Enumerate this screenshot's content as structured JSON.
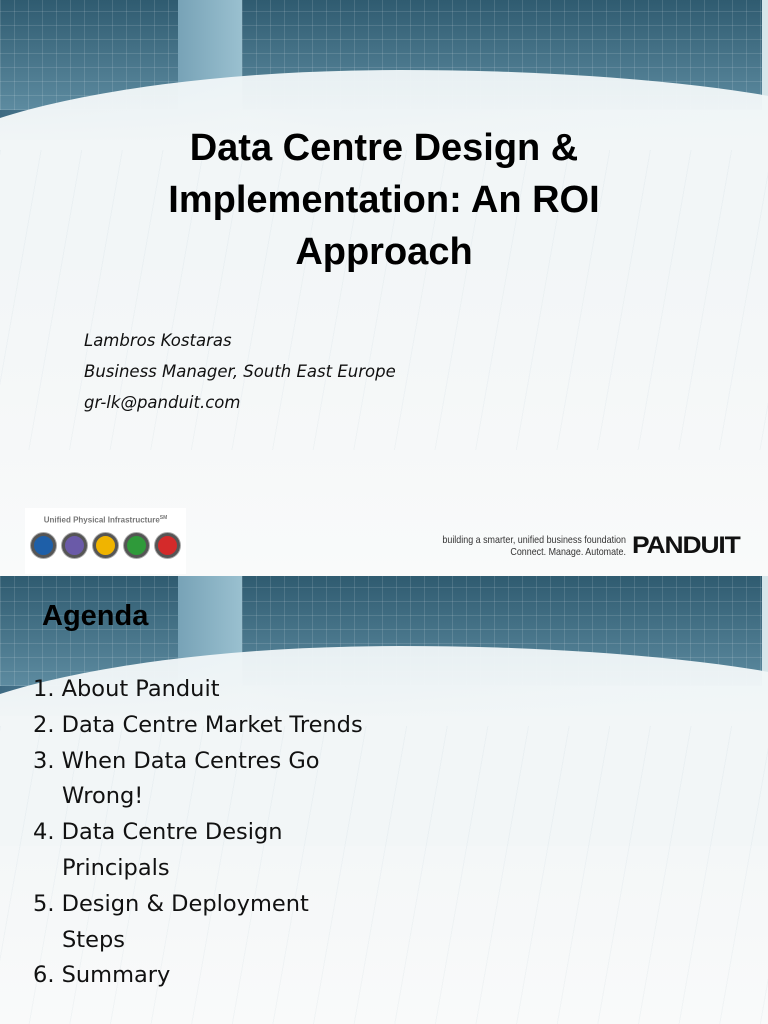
{
  "slide1": {
    "title": "Data Centre Design & Implementation: An ROI Approach",
    "author": {
      "name": "Lambros Kostaras",
      "role": "Business Manager, South East Europe",
      "email": "gr-lk@panduit.com"
    },
    "upi_logo": {
      "text": "Unified Physical Infrastructure",
      "mark": "SM",
      "icon_colors": [
        "#1e5fa8",
        "#6a5aa8",
        "#f0b400",
        "#2f9a3a",
        "#d42a2a"
      ]
    },
    "tagline": "building a smarter, unified business foundation",
    "slogan": "Connect. Manage. Automate.",
    "brand": "PANDUIT"
  },
  "slide2": {
    "title": "Agenda",
    "items": [
      {
        "num": "1.",
        "text": "About Panduit",
        "cont": ""
      },
      {
        "num": "2.",
        "text": "Data Centre Market Trends",
        "cont": ""
      },
      {
        "num": "3.",
        "text": "When Data Centres Go",
        "cont": "Wrong!"
      },
      {
        "num": "4.",
        "text": "Data Centre Design",
        "cont": "Principals"
      },
      {
        "num": "5.",
        "text": "Design & Deployment",
        "cont": "Steps"
      },
      {
        "num": "6.",
        "text": "Summary",
        "cont": ""
      }
    ]
  }
}
